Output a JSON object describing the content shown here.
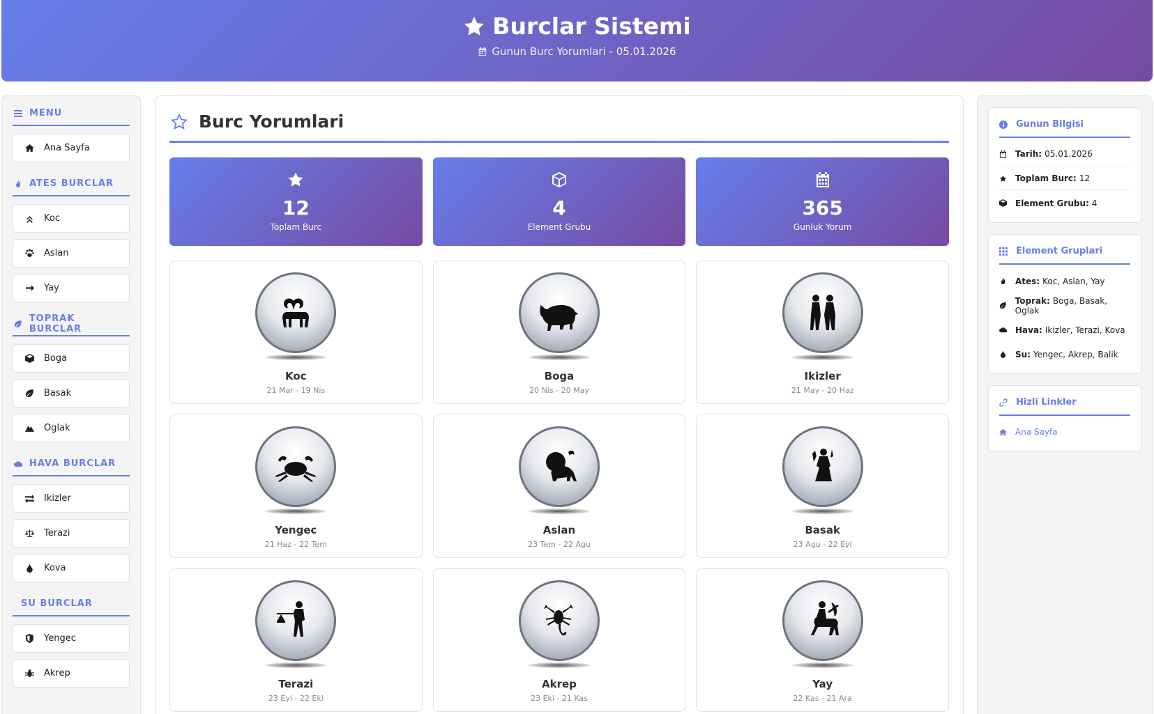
{
  "header": {
    "title": "Burclar Sistemi",
    "subtitle": "Gunun Burc Yorumlari - 05.01.2026"
  },
  "colors": {
    "accent": "#667eea",
    "accent_dark": "#764ba2"
  },
  "sidebar": {
    "menu_title": "MENU",
    "home": "Ana Sayfa",
    "groups": [
      {
        "title": "ATES BURCLAR",
        "items": [
          "Koc",
          "Aslan",
          "Yay"
        ]
      },
      {
        "title": "TOPRAK BURCLAR",
        "items": [
          "Boga",
          "Basak",
          "Oglak"
        ]
      },
      {
        "title": "HAVA BURCLAR",
        "items": [
          "Ikizler",
          "Terazi",
          "Kova"
        ]
      },
      {
        "title": "SU BURCLAR",
        "items": [
          "Yengec",
          "Akrep"
        ]
      }
    ]
  },
  "main": {
    "title": "Burc Yorumlari",
    "stats": [
      {
        "value": "12",
        "label": "Toplam Burc",
        "icon": "star-icon"
      },
      {
        "value": "4",
        "label": "Element Grubu",
        "icon": "cube-icon"
      },
      {
        "value": "365",
        "label": "Gunluk Yorum",
        "icon": "calendar-icon"
      }
    ],
    "signs": [
      {
        "name": "Koc",
        "dates": "21 Mar - 19 Nis",
        "icon": "aries-icon"
      },
      {
        "name": "Boga",
        "dates": "20 Nis - 20 May",
        "icon": "taurus-icon"
      },
      {
        "name": "Ikizler",
        "dates": "21 May - 20 Haz",
        "icon": "gemini-icon"
      },
      {
        "name": "Yengec",
        "dates": "21 Haz - 22 Tem",
        "icon": "cancer-icon"
      },
      {
        "name": "Aslan",
        "dates": "23 Tem - 22 Agu",
        "icon": "leo-icon"
      },
      {
        "name": "Basak",
        "dates": "23 Agu - 22 Eyl",
        "icon": "virgo-icon"
      },
      {
        "name": "Terazi",
        "dates": "23 Eyl - 22 Eki",
        "icon": "libra-icon"
      },
      {
        "name": "Akrep",
        "dates": "23 Eki - 21 Kas",
        "icon": "scorpio-icon"
      },
      {
        "name": "Yay",
        "dates": "22 Kas - 21 Ara",
        "icon": "sagittarius-icon"
      }
    ]
  },
  "rightbar": {
    "info": {
      "title": "Gunun Bilgisi",
      "rows": [
        {
          "label": "Tarih:",
          "value": "05.01.2026"
        },
        {
          "label": "Toplam Burc:",
          "value": "12"
        },
        {
          "label": "Element Grubu:",
          "value": "4"
        }
      ]
    },
    "elements": {
      "title": "Element Gruplari",
      "rows": [
        {
          "label": "Ates:",
          "value": "Koc, Aslan, Yay"
        },
        {
          "label": "Toprak:",
          "value": "Boga, Basak, Oglak"
        },
        {
          "label": "Hava:",
          "value": "Ikizler, Terazi, Kova"
        },
        {
          "label": "Su:",
          "value": "Yengec, Akrep, Balik"
        }
      ]
    },
    "links": {
      "title": "Hizli Linkler",
      "items": [
        "Ana Sayfa"
      ]
    }
  }
}
